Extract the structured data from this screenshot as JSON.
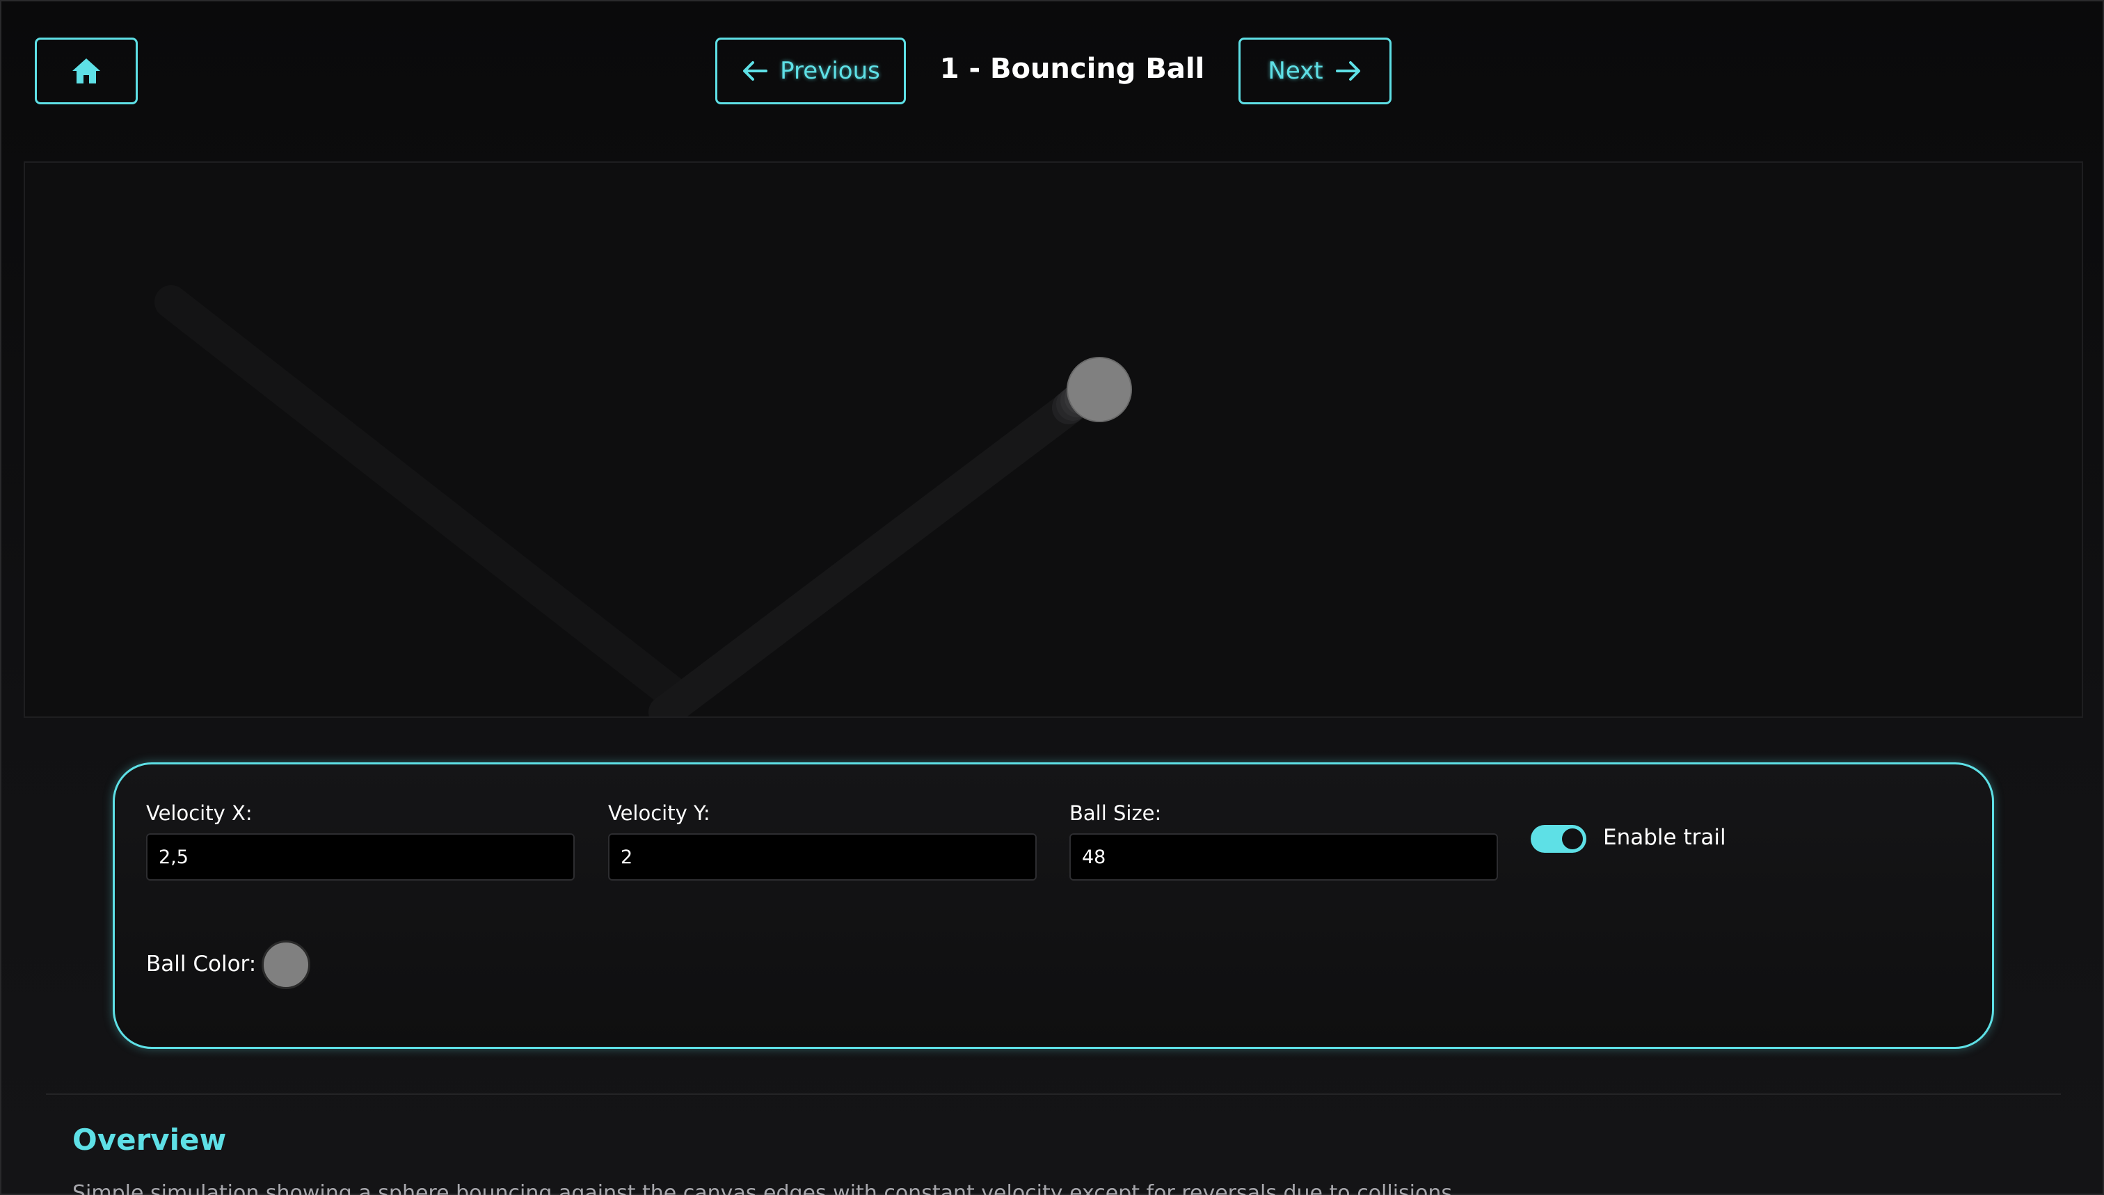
{
  "header": {
    "home_icon": "home-icon",
    "previous_label": "Previous",
    "next_label": "Next",
    "title": "1 - Bouncing Ball"
  },
  "controls": {
    "velocity_x": {
      "label": "Velocity X:",
      "value": "2,5"
    },
    "velocity_y": {
      "label": "Velocity Y:",
      "value": "2"
    },
    "ball_size": {
      "label": "Ball Size:",
      "value": "48"
    },
    "trail": {
      "label": "Enable trail",
      "enabled": true
    },
    "ball_color": {
      "label": "Ball Color:",
      "value": "#808080"
    }
  },
  "overview": {
    "title": "Overview",
    "text": "Simple simulation showing a sphere bouncing against the canvas edges with constant velocity except for reversals due to collisions."
  },
  "colors": {
    "accent": "#5ee0e6",
    "background": "#0c0c0d",
    "ball": "#808080"
  }
}
